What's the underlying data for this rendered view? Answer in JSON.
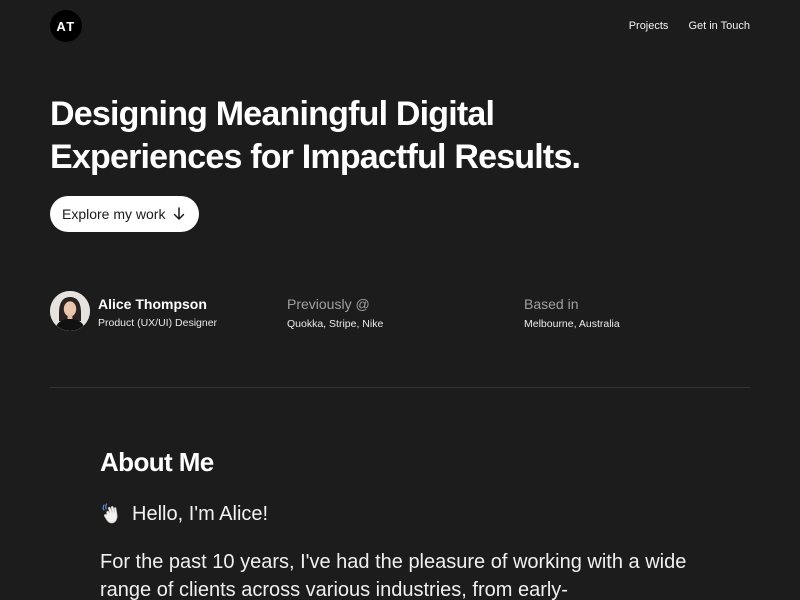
{
  "header": {
    "logo_text": "AT",
    "nav": [
      {
        "label": "Projects"
      },
      {
        "label": "Get in Touch"
      }
    ]
  },
  "hero": {
    "title_line1": "Designing Meaningful Digital",
    "title_line2": "Experiences for Impactful Results.",
    "cta_label": "Explore my work",
    "cta_icon": "arrow-down-icon"
  },
  "profile": {
    "name": "Alice Thompson",
    "role": "Product (UX/UI) Designer",
    "previously_label": "Previously @",
    "previously_value": "Quokka, Stripe, Nike",
    "based_label": "Based in",
    "based_value": "Melbourne, Australia"
  },
  "about": {
    "title": "About Me",
    "hello_icon": "waving-hand-icon",
    "hello": "Hello, I'm Alice!",
    "body": "For the past 10 years, I've had the pleasure of working with a wide range of clients across various industries, from early-"
  },
  "colors": {
    "background": "#1c1c1c",
    "text": "#ffffff",
    "muted": "#a0a0a0",
    "button_bg": "#ffffff",
    "divider": "#333333"
  }
}
